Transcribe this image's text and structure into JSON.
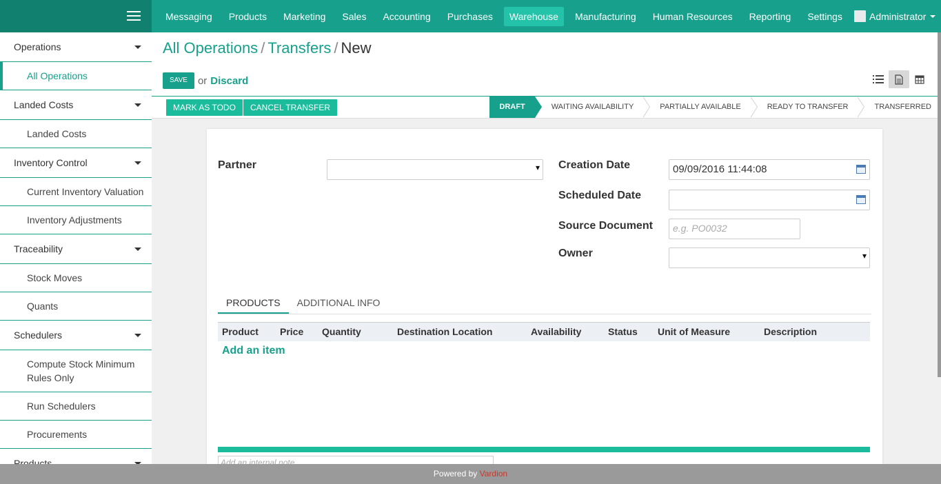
{
  "topbar": {
    "menu": [
      "Messaging",
      "Products",
      "Marketing",
      "Sales",
      "Accounting",
      "Purchases",
      "Warehouse",
      "Manufacturing",
      "Human Resources",
      "Reporting",
      "Settings"
    ],
    "active_menu": "Warehouse",
    "user": "Administrator"
  },
  "sidebar": {
    "sections": [
      {
        "label": "Operations",
        "items": [
          "All Operations"
        ]
      },
      {
        "label": "Landed Costs",
        "items": [
          "Landed Costs"
        ]
      },
      {
        "label": "Inventory Control",
        "items": [
          "Current Inventory Valuation",
          "Inventory Adjustments"
        ]
      },
      {
        "label": "Traceability",
        "items": [
          "Stock Moves",
          "Quants"
        ]
      },
      {
        "label": "Schedulers",
        "items": [
          "Compute Stock Minimum Rules Only",
          "Run Schedulers",
          "Procurements"
        ]
      },
      {
        "label": "Products",
        "items": []
      }
    ],
    "active_item": "All Operations"
  },
  "breadcrumb": {
    "level1": "All Operations",
    "level2": "Transfers",
    "current": "New",
    "sep": "/"
  },
  "actions": {
    "save": "SAVE",
    "or": "or",
    "discard": "Discard"
  },
  "status": {
    "buttons": {
      "mark_todo": "MARK AS TODO",
      "cancel": "CANCEL TRANSFER"
    },
    "stages": [
      "DRAFT",
      "WAITING AVAILABILITY",
      "PARTIALLY AVAILABLE",
      "READY TO TRANSFER",
      "TRANSFERRED"
    ],
    "active_stage": "DRAFT"
  },
  "form": {
    "partner_label": "Partner",
    "partner_value": "",
    "creation_date_label": "Creation Date",
    "creation_date_value": "09/09/2016 11:44:08",
    "scheduled_date_label": "Scheduled Date",
    "scheduled_date_value": "",
    "source_document_label": "Source Document",
    "source_document_placeholder": "e.g. PO0032",
    "owner_label": "Owner",
    "owner_value": ""
  },
  "tabs": [
    "PRODUCTS",
    "ADDITIONAL INFO"
  ],
  "table": {
    "columns": [
      "Product",
      "Price",
      "Quantity",
      "Destination Location",
      "Availability",
      "Status",
      "Unit of Measure",
      "Description"
    ],
    "add_item": "Add an item"
  },
  "note_placeholder": "Add an internal note...",
  "footer": {
    "text": "Powered by",
    "brand": "Vardion"
  },
  "colors": {
    "primary": "#17a08b",
    "accent": "#1abc9c",
    "brand": "#c0392b"
  }
}
